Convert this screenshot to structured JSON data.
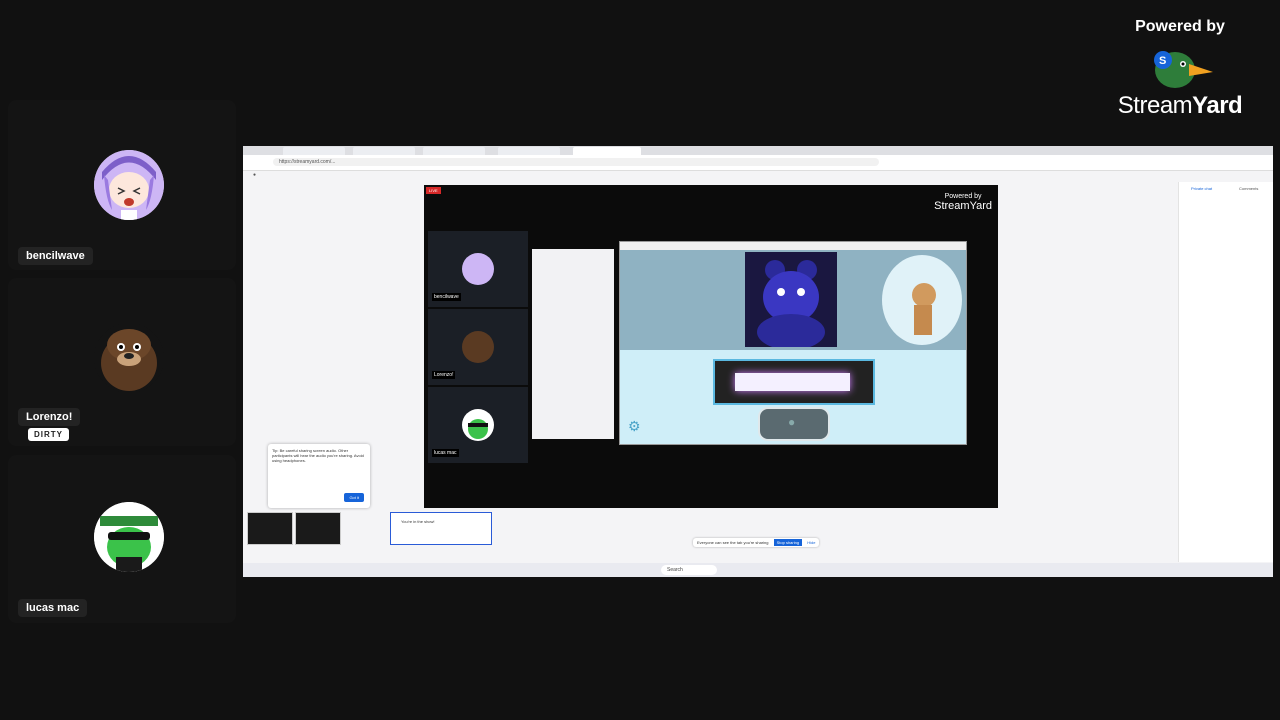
{
  "participants": [
    {
      "name": "bencilwave"
    },
    {
      "name": "Lorenzo!",
      "badge": "DIRTY"
    },
    {
      "name": "lucas mac"
    }
  ],
  "branding": {
    "powered_by": "Powered by",
    "name_light": "Stream",
    "name_bold": "Yard"
  },
  "screen_share": {
    "url": "https://streamyard.com/...",
    "stage_participants": [
      {
        "name": "bencilwave"
      },
      {
        "name": "Lorenzo!"
      },
      {
        "name": "lucas mac"
      }
    ],
    "stage_brand": {
      "powered_by": "Powered by",
      "name": "StreamYard"
    },
    "right_tabs": [
      "Private chat",
      "Comments"
    ],
    "share_notice": "Everyone can see the tab you're sharing",
    "share_button": "Stop sharing",
    "hide_button": "Hide",
    "toast_text": "Tip: Be careful sharing screen audio. Other participants will hear the audio you're sharing. Avoid using headphones.",
    "toast_button": "Got it",
    "in_show": "You're in the show!",
    "search": "Search"
  },
  "colors": {
    "background": "#111111",
    "tile": "#141414",
    "accent": "#1664d9",
    "live": "#d62828"
  }
}
